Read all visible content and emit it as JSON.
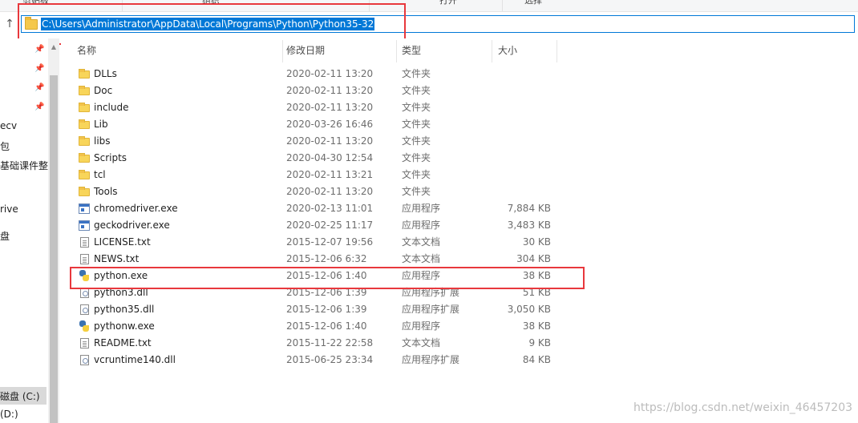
{
  "ribbon": {
    "items": [
      "剪贴板",
      "组织",
      "打开",
      "选择"
    ]
  },
  "address": {
    "path": "C:\\Users\\Administrator\\AppData\\Local\\Programs\\Python\\Python35-32"
  },
  "nav": {
    "items": [
      "ecv",
      "包",
      "基础课件整",
      "rive",
      "盘",
      "磁盘 (C:)",
      "(D:)"
    ]
  },
  "columns": {
    "name": "名称",
    "date": "修改日期",
    "type": "类型",
    "size": "大小"
  },
  "files": [
    {
      "name": "DLLs",
      "date": "2020-02-11 13:20",
      "type": "文件夹",
      "size": "",
      "icon": "folder-icon"
    },
    {
      "name": "Doc",
      "date": "2020-02-11 13:20",
      "type": "文件夹",
      "size": "",
      "icon": "folder-icon"
    },
    {
      "name": "include",
      "date": "2020-02-11 13:20",
      "type": "文件夹",
      "size": "",
      "icon": "folder-icon"
    },
    {
      "name": "Lib",
      "date": "2020-03-26 16:46",
      "type": "文件夹",
      "size": "",
      "icon": "folder-icon"
    },
    {
      "name": "libs",
      "date": "2020-02-11 13:20",
      "type": "文件夹",
      "size": "",
      "icon": "folder-icon"
    },
    {
      "name": "Scripts",
      "date": "2020-04-30 12:54",
      "type": "文件夹",
      "size": "",
      "icon": "folder-icon"
    },
    {
      "name": "tcl",
      "date": "2020-02-11 13:21",
      "type": "文件夹",
      "size": "",
      "icon": "folder-icon"
    },
    {
      "name": "Tools",
      "date": "2020-02-11 13:20",
      "type": "文件夹",
      "size": "",
      "icon": "folder-icon"
    },
    {
      "name": "chromedriver.exe",
      "date": "2020-02-13 11:01",
      "type": "应用程序",
      "size": "7,884 KB",
      "icon": "exe-icon"
    },
    {
      "name": "geckodriver.exe",
      "date": "2020-02-25 11:17",
      "type": "应用程序",
      "size": "3,483 KB",
      "icon": "exe-icon"
    },
    {
      "name": "LICENSE.txt",
      "date": "2015-12-07 19:56",
      "type": "文本文档",
      "size": "30 KB",
      "icon": "text-file-icon"
    },
    {
      "name": "NEWS.txt",
      "date": "2015-12-06 6:32",
      "type": "文本文档",
      "size": "304 KB",
      "icon": "text-file-icon"
    },
    {
      "name": "python.exe",
      "date": "2015-12-06 1:40",
      "type": "应用程序",
      "size": "38 KB",
      "icon": "python-icon"
    },
    {
      "name": "python3.dll",
      "date": "2015-12-06 1:39",
      "type": "应用程序扩展",
      "size": "51 KB",
      "icon": "dll-icon"
    },
    {
      "name": "python35.dll",
      "date": "2015-12-06 1:39",
      "type": "应用程序扩展",
      "size": "3,050 KB",
      "icon": "dll-icon"
    },
    {
      "name": "pythonw.exe",
      "date": "2015-12-06 1:40",
      "type": "应用程序",
      "size": "38 KB",
      "icon": "python-icon"
    },
    {
      "name": "README.txt",
      "date": "2015-11-22 22:58",
      "type": "文本文档",
      "size": "9 KB",
      "icon": "text-file-icon"
    },
    {
      "name": "vcruntime140.dll",
      "date": "2015-06-25 23:34",
      "type": "应用程序扩展",
      "size": "84 KB",
      "icon": "dll-icon"
    }
  ],
  "watermark": "https://blog.csdn.net/weixin_46457203",
  "colors": {
    "accent": "#0078d7",
    "highlight": "#e8383d"
  }
}
